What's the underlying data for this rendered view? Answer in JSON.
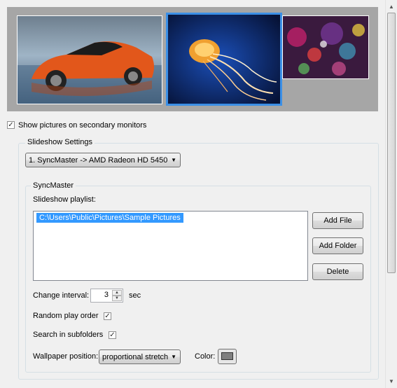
{
  "secondary_monitors": {
    "label": "Show pictures on secondary monitors",
    "checked": true
  },
  "slideshow_settings": {
    "title": "Slideshow Settings",
    "monitor_select": "1. SyncMaster -> AMD Radeon HD 5450",
    "monitor_group": {
      "title": "SyncMaster",
      "playlist_label": "Slideshow playlist:",
      "playlist_items": [
        "C:\\Users\\Public\\Pictures\\Sample Pictures"
      ],
      "add_file": "Add File",
      "add_folder": "Add Folder",
      "delete": "Delete",
      "interval_label": "Change interval:",
      "interval_value": "3",
      "interval_unit": "sec",
      "random_label": "Random play order",
      "random_checked": true,
      "subfolders_label": "Search in subfolders",
      "subfolders_checked": true,
      "position_label": "Wallpaper position:",
      "position_value": "proportional stretch",
      "color_label": "Color:",
      "color_value": "#808080"
    }
  },
  "preview": {
    "thumbnails": [
      "car-wallpaper",
      "jellyfish-wallpaper",
      "abstract-circles-wallpaper"
    ],
    "selected_index": 1
  }
}
